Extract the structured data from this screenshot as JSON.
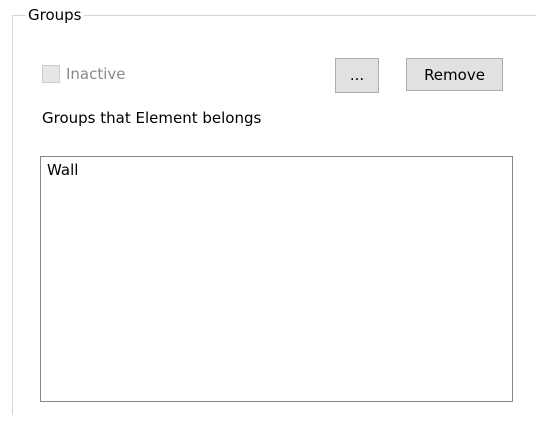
{
  "groupbox": {
    "title": "Groups"
  },
  "inactive_checkbox": {
    "label": "Inactive",
    "checked": false,
    "enabled": false
  },
  "buttons": {
    "browse_label": "...",
    "remove_label": "Remove"
  },
  "groups_list": {
    "caption": "Groups that Element belongs",
    "items": [
      {
        "label": "Wall"
      }
    ]
  }
}
